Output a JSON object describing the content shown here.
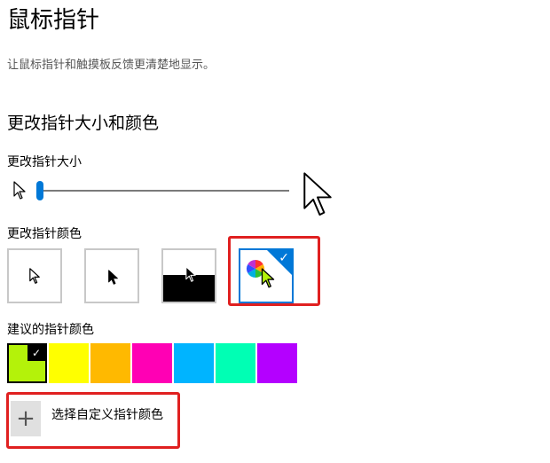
{
  "page": {
    "title": "鼠标指针",
    "description": "让鼠标指针和触摸板反馈更清楚地显示。"
  },
  "size_section": {
    "heading": "更改指针大小和颜色",
    "size_label": "更改指针大小",
    "slider_value_fraction": 0.0
  },
  "color_section": {
    "label": "更改指针颜色",
    "options": [
      {
        "id": "white",
        "selected": false
      },
      {
        "id": "black",
        "selected": false
      },
      {
        "id": "inverted",
        "selected": false
      },
      {
        "id": "custom",
        "selected": true
      }
    ]
  },
  "suggested": {
    "label": "建议的指针颜色",
    "swatches": [
      "#b4f20a",
      "#ffff00",
      "#ffb900",
      "#ff00b4",
      "#00b4ff",
      "#00ffb4",
      "#b400ff"
    ],
    "selected_index": 0
  },
  "custom": {
    "label": "选择自定义指针颜色",
    "icon": "plus-icon"
  },
  "colors": {
    "accent": "#0078d7",
    "highlight": "#e02020",
    "custom_cursor": "#b4f20a"
  }
}
